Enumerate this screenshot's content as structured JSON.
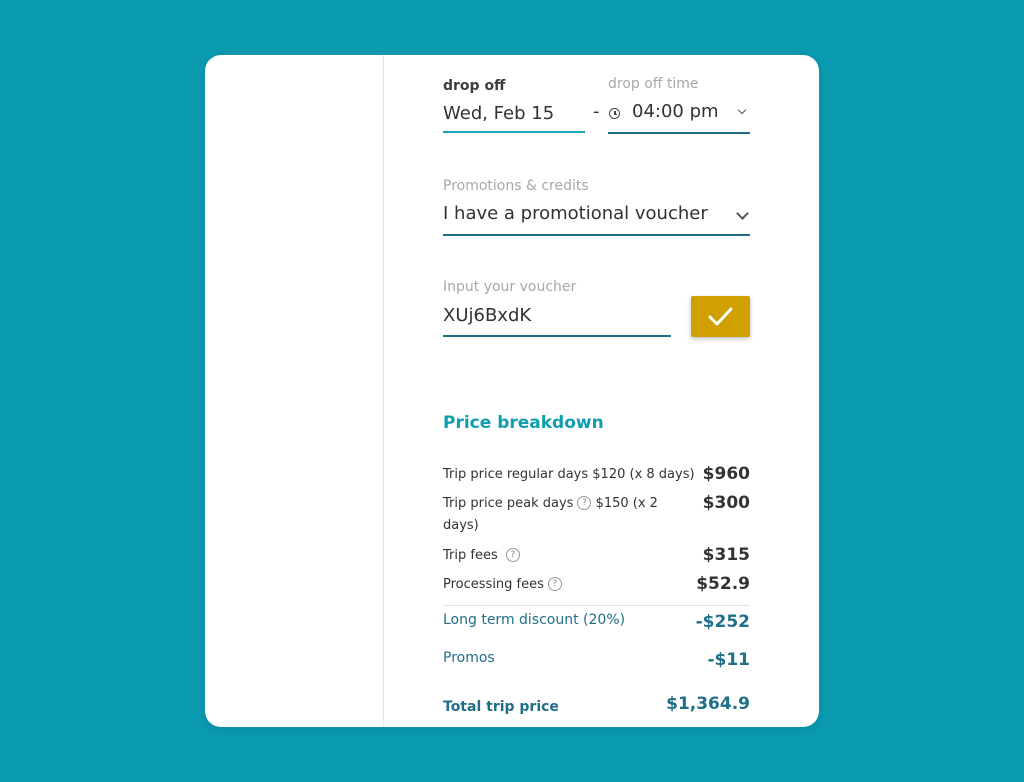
{
  "dropoff": {
    "date_label": "drop off",
    "date_value": "Wed, Feb 15",
    "separator": "-",
    "time_label": "drop off time",
    "time_value": "04:00 pm"
  },
  "promotions": {
    "label": "Promotions & credits",
    "selected": "I have a promotional voucher"
  },
  "voucher": {
    "label": "Input your voucher",
    "value": "XUj6BxdK"
  },
  "price_breakdown": {
    "title": "Price breakdown",
    "rows": [
      {
        "label": "Trip price regular days $120 (x 8 days)",
        "amount": "$960"
      },
      {
        "label_a": "Trip price peak days",
        "label_b": "$150 (x 2",
        "label_c": "days)",
        "amount": "$300"
      },
      {
        "label": "Trip fees",
        "amount": "$315"
      },
      {
        "label": "Processing fees",
        "amount": "$52.9"
      },
      {
        "label": "Long term discount (20%)",
        "amount": "-$252"
      },
      {
        "label": "Promos",
        "amount": "-$11"
      }
    ],
    "total_label": "Total trip price",
    "total_amount": "$1,364.9",
    "help_glyph": "?"
  },
  "colors": {
    "background": "#0b9bb0",
    "accent_teal": "#0f9eb0",
    "dark_teal": "#1f6f88",
    "confirm_button": "#cfa000",
    "annotation_arrow": "#3cb44a"
  },
  "icons": [
    "clock-icon",
    "chevron-down-icon",
    "check-icon",
    "help-icon",
    "arrow-icon"
  ]
}
